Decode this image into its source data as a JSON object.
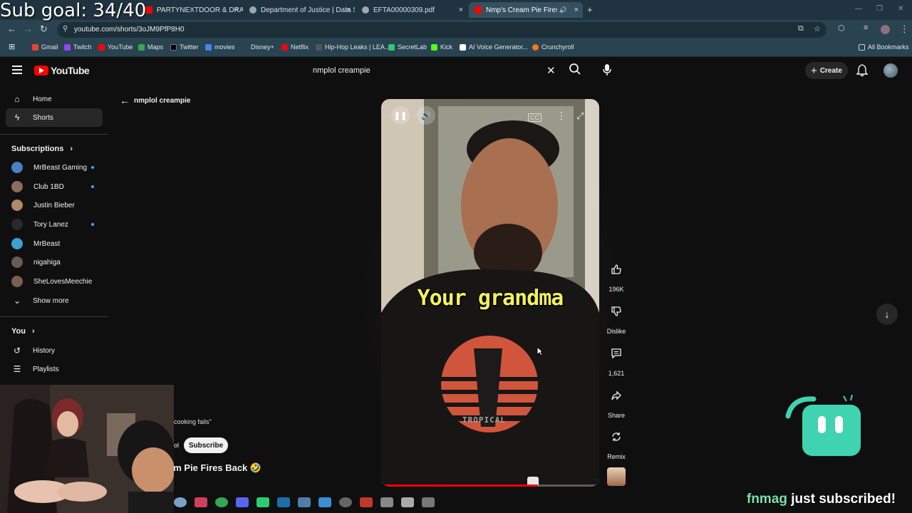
{
  "overlay": {
    "sub_goal": "Sub goal: 34/40",
    "notification_name": "fnmag",
    "notification_text": " just subscribed!"
  },
  "browser": {
    "tabs": [
      {
        "label": "",
        "active": false,
        "color": "#c33"
      },
      {
        "label": "PARTYNEXTDOOR & DRAKE - I",
        "active": false,
        "color": "#ff0000"
      },
      {
        "label": "Department of Justice | Data Se",
        "active": false,
        "color": "#9aa"
      },
      {
        "label": "EFTA00000309.pdf",
        "active": false,
        "color": "#9aa"
      },
      {
        "label": "Nmp's Cream Pie Fires Back",
        "active": true,
        "color": "#ff0000"
      }
    ],
    "url": "youtube.com/shorts/3oJM9PfP8H0",
    "bookmarks": [
      {
        "label": "Gmail",
        "color": "#ea4335"
      },
      {
        "label": "Twitch",
        "color": "#9146ff"
      },
      {
        "label": "YouTube",
        "color": "#ff0000"
      },
      {
        "label": "Maps",
        "color": "#34a853"
      },
      {
        "label": "Twitter",
        "color": "#000000"
      },
      {
        "label": "movies",
        "color": "#4285f4"
      },
      {
        "label": "Disney+",
        "color": "#113ccf"
      },
      {
        "label": "Netflix",
        "color": "#e50914"
      },
      {
        "label": "Hip-Hop Leaks | LEA...",
        "color": "#555555"
      },
      {
        "label": "SecretLab",
        "color": "#2ecc71"
      },
      {
        "label": "Kick",
        "color": "#53fc18"
      },
      {
        "label": "AI Voice Generator...",
        "color": "#ffffff"
      },
      {
        "label": "Crunchyroll",
        "color": "#f47521"
      }
    ],
    "all_bookmarks": "All Bookmarks"
  },
  "header": {
    "logo_text": "YouTube",
    "search_value": "nmplol creampie",
    "create_label": "Create"
  },
  "sidebar": {
    "home": "Home",
    "shorts": "Shorts",
    "subscriptions_title": "Subscriptions",
    "subscriptions": [
      {
        "name": "MrBeast Gaming",
        "new": true,
        "color": "#4a7fc1"
      },
      {
        "name": "Club 1BD",
        "new": true,
        "color": "#8a6d5a"
      },
      {
        "name": "Justin Bieber",
        "new": false,
        "color": "#b08968"
      },
      {
        "name": "Tory Lanez",
        "new": true,
        "color": "#2a2a2a"
      },
      {
        "name": "MrBeast",
        "new": false,
        "color": "#3aa0d0"
      },
      {
        "name": "nigahiga",
        "new": false,
        "color": "#6b5a4e"
      },
      {
        "name": "SheLovesMeechie",
        "new": false,
        "color": "#7a5e50"
      }
    ],
    "show_more": "Show more",
    "you_title": "You",
    "history": "History",
    "playlists": "Playlists"
  },
  "main": {
    "back_label": "nmplol creampie",
    "caption": "Your grandma",
    "shirt_text": "TROPICAL",
    "progress_fraction": 0.72,
    "actions": {
      "likes": "196K",
      "dislike": "Dislike",
      "comments": "1,621",
      "share": "Share",
      "remix": "Remix"
    },
    "snippet_quote": "cooking fails\"",
    "snippet_channel": "ol",
    "subscribe_label": "Subscribe",
    "title_fragment": "am Pie Fires Back 🤣"
  }
}
